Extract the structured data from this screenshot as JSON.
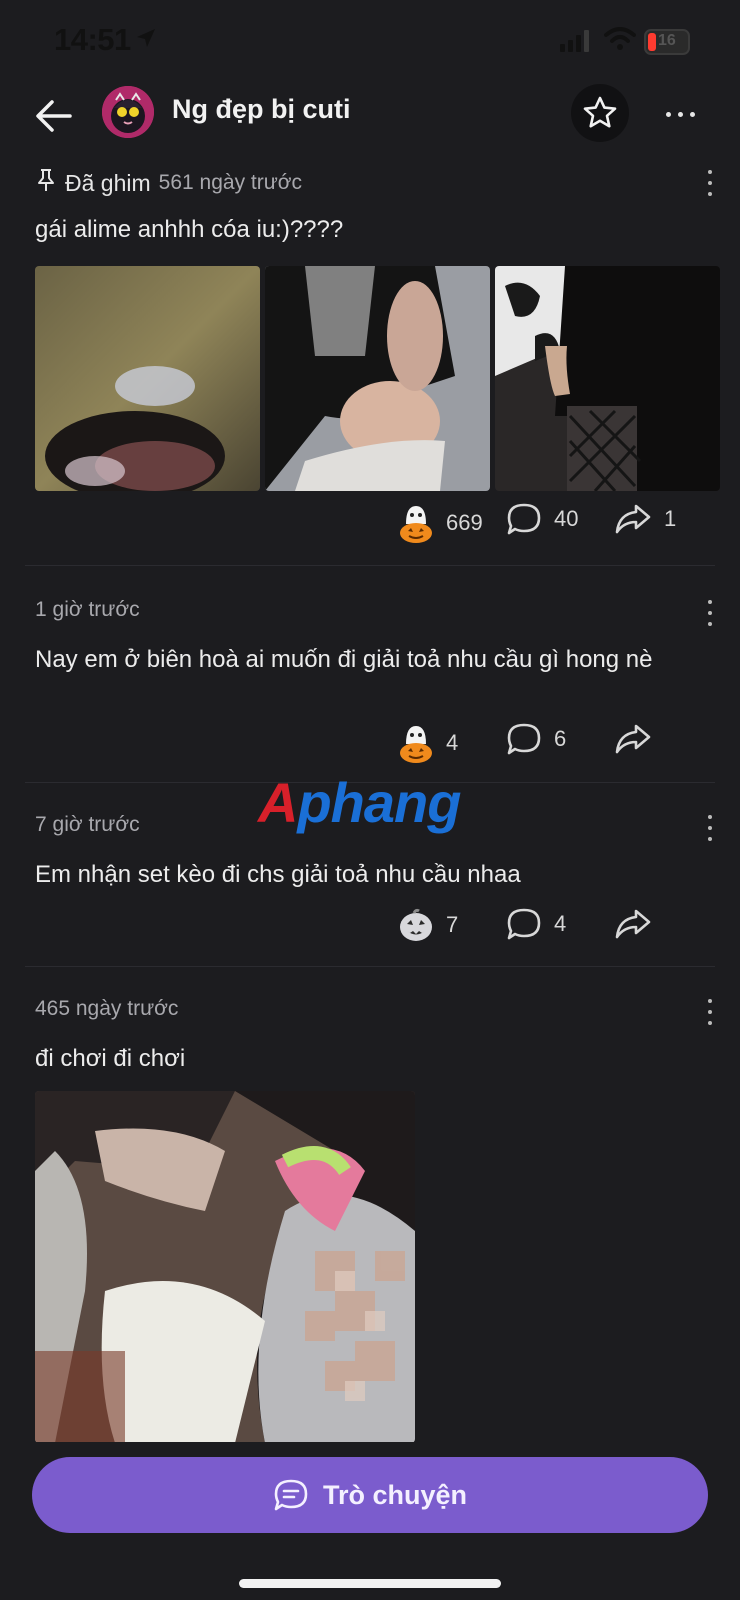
{
  "status_bar": {
    "time": "14:51",
    "battery": "16"
  },
  "header": {
    "title": "Ng đẹp bị cuti"
  },
  "posts": [
    {
      "pinned_label": "Đã ghim",
      "time": "561 ngày trước",
      "text": "gái alime anhhh cóa iu:)????",
      "reactions": "669",
      "comments": "40",
      "shares": "1"
    },
    {
      "time": "1 giờ trước",
      "text": "Nay em ở biên hoà ai muốn đi giải toả nhu cầu gì hong nè",
      "reactions": "4",
      "comments": "6"
    },
    {
      "time": "7 giờ trước",
      "text": "Em nhận set kèo đi chs giải toả nhu cầu nhaa",
      "reactions": "7",
      "comments": "4"
    },
    {
      "time": "465 ngày trước",
      "text": "đi chơi đi chơi"
    }
  ],
  "watermark": {
    "part1": "A",
    "part2": "phang"
  },
  "chat_button": {
    "label": "Trò chuyện"
  },
  "colors": {
    "background": "#1c1c1f",
    "accent": "#7b5ccd",
    "text": "#ececec",
    "muted": "#a8a8ad"
  },
  "icons": [
    "back-arrow-icon",
    "star-icon",
    "more-icon",
    "pin-icon",
    "ghost-pumpkin-icon",
    "comment-icon",
    "share-icon",
    "chat-icon"
  ]
}
